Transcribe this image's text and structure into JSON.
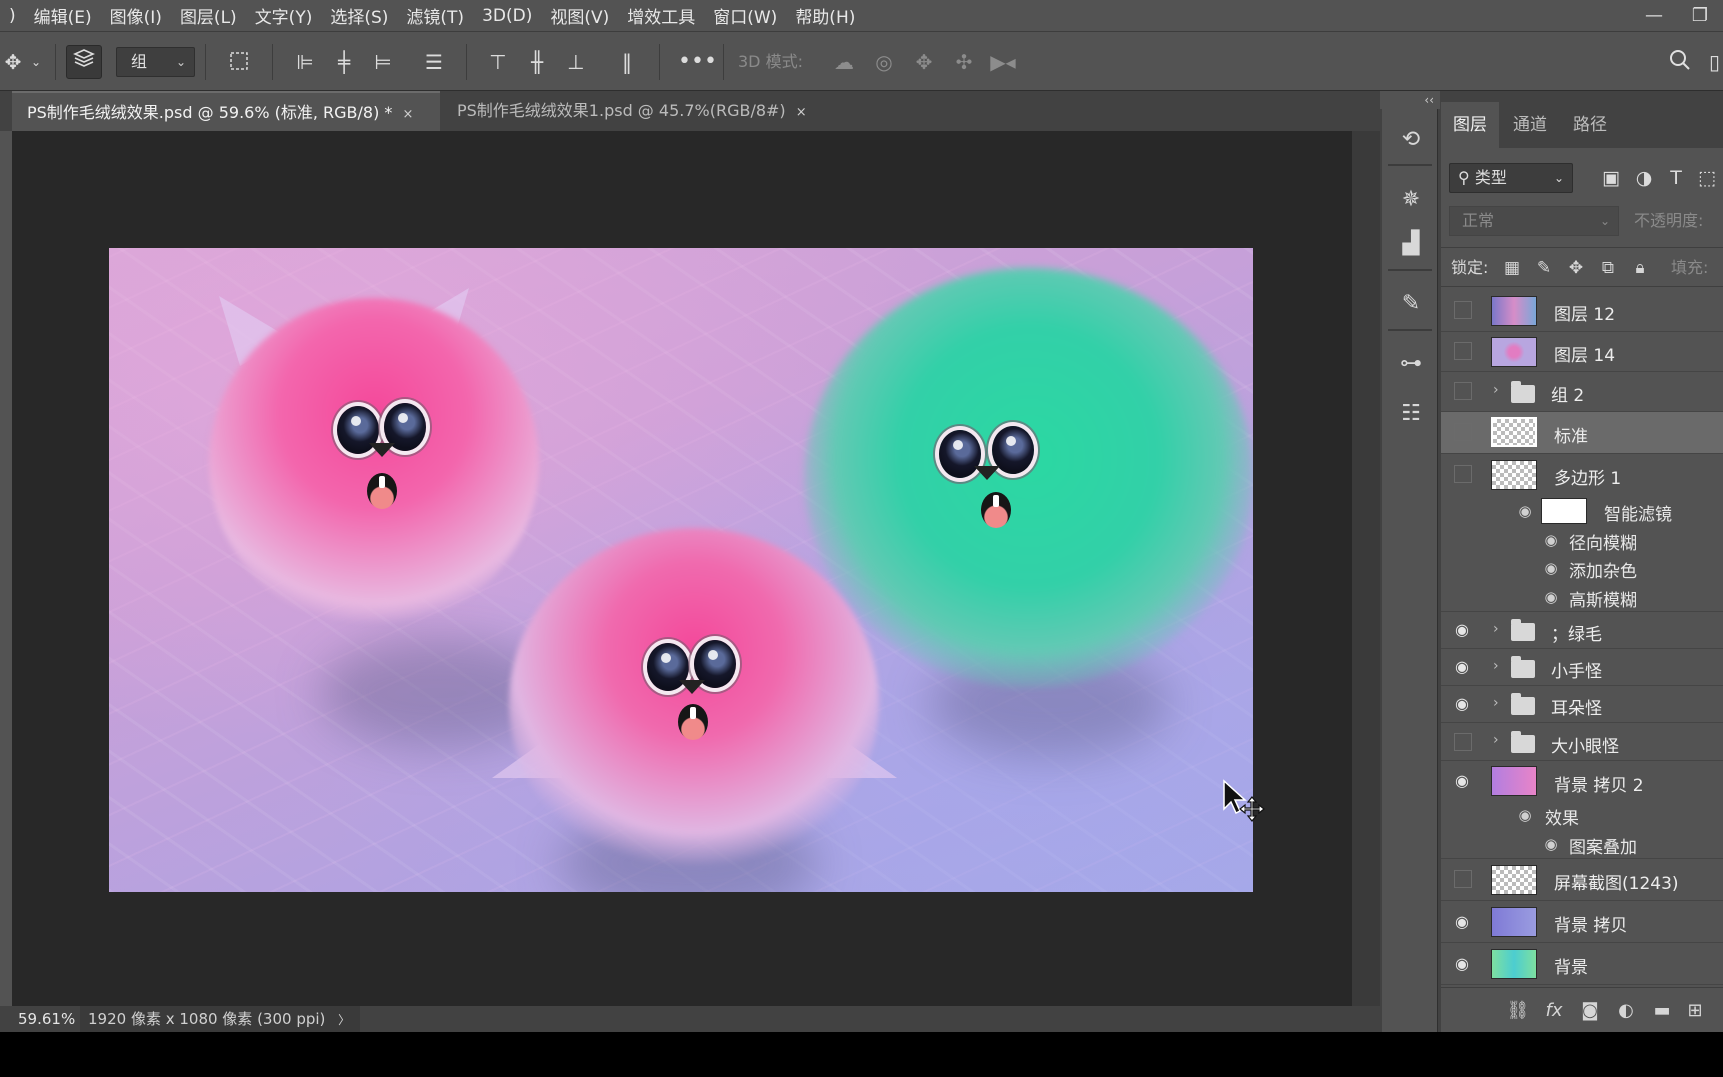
{
  "menubar": {
    "items": [
      ")",
      "编辑(E)",
      "图像(I)",
      "图层(L)",
      "文字(Y)",
      "选择(S)",
      "滤镜(T)",
      "3D(D)",
      "视图(V)",
      "增效工具",
      "窗口(W)",
      "帮助(H)"
    ],
    "minimize": "—",
    "restore": "❐"
  },
  "options": {
    "group_select_value": "组",
    "mode_3d_label": "3D 模式:"
  },
  "tabs": [
    {
      "title": "PS制作毛绒绒效果.psd @ 59.6% (标准, RGB/8) *",
      "close": "×",
      "active": true
    },
    {
      "title": "PS制作毛绒绒效果1.psd @ 45.7%(RGB/8#)",
      "close": "×",
      "active": false
    }
  ],
  "status": {
    "zoom": "59.61%",
    "doc_info": "1920 像素 x 1080 像素 (300 ppi)",
    "arrow": "〉"
  },
  "panel": {
    "collapse_glyph": "‹‹",
    "tabs": [
      "图层",
      "通道",
      "路径"
    ],
    "filter_label": "类型",
    "blend_mode": "正常",
    "opacity_label": "不透明度:",
    "lock_label": "锁定:",
    "fill_label": "填充:"
  },
  "layers": {
    "l1": "图层 12",
    "l2": "图层 14",
    "l3": "组 2",
    "l4": "标准",
    "l5": "多边形 1",
    "l5_sub": "智能滤镜",
    "l5_f1": "径向模糊",
    "l5_f2": "添加杂色",
    "l5_f3": "高斯模糊",
    "l6": "；绿毛",
    "l7": "小手怪",
    "l8": "耳朵怪",
    "l9": "大小眼怪",
    "l10": "背景 拷贝 2",
    "l10_sub": "效果",
    "l10_f1": "图案叠加",
    "l11": "屏幕截图(1243)",
    "l12": "背景 拷贝",
    "l13": "背景"
  },
  "colors": {
    "pink_fur": "#f05aa6",
    "green_fur": "#2fd49e",
    "canvas_bg": "#c9a0d8"
  }
}
